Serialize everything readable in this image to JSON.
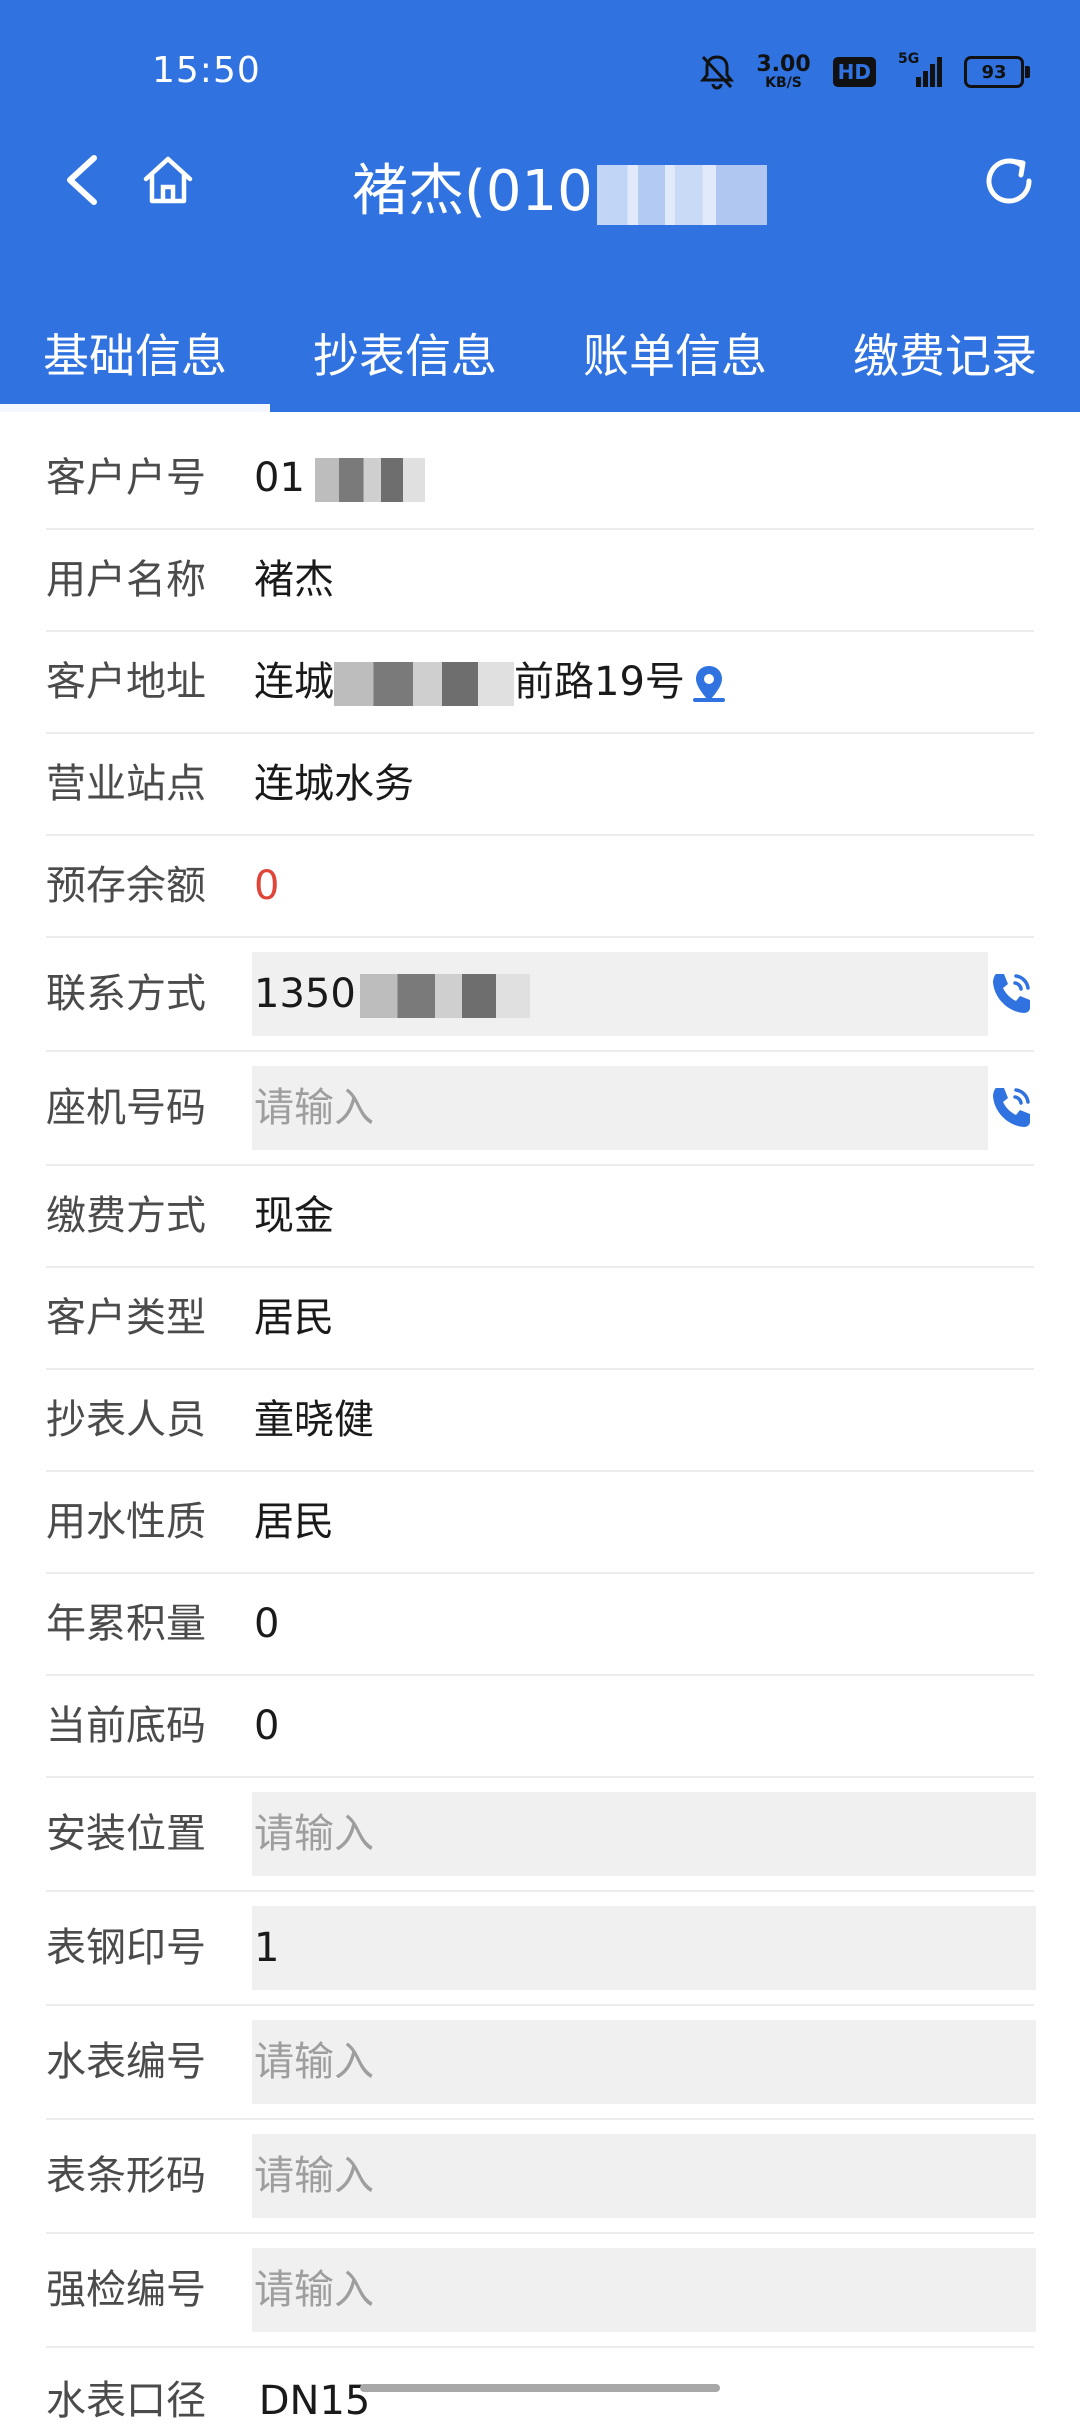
{
  "status_bar": {
    "time": "15:50",
    "net_speed": "3.00",
    "net_unit": "KB/S",
    "hd": "HD",
    "signal": "5G",
    "battery": "93",
    "icons": [
      "bell-off-icon",
      "signal-icon",
      "battery-icon"
    ]
  },
  "header": {
    "title": "褚杰(010",
    "back": "back-icon",
    "home": "home-icon",
    "refresh": "refresh-icon"
  },
  "tabs": [
    {
      "label": "基础信息",
      "active": true
    },
    {
      "label": "抄表信息",
      "active": false
    },
    {
      "label": "账单信息",
      "active": false
    },
    {
      "label": "缴费记录",
      "active": false
    }
  ],
  "fields": [
    {
      "label": "客户户号",
      "value": "01"
    },
    {
      "label": "用户名称",
      "value": "褚杰"
    },
    {
      "label": "客户地址",
      "value_start": "连城",
      "value_end": "前路19号"
    },
    {
      "label": "营业站点",
      "value": "连城水务"
    },
    {
      "label": "预存余额",
      "value": "0"
    },
    {
      "label": "联系方式",
      "value": "1350"
    },
    {
      "label": "座机号码",
      "placeholder": "请输入"
    },
    {
      "label": "缴费方式",
      "value": "现金"
    },
    {
      "label": "客户类型",
      "value": "居民"
    },
    {
      "label": "抄表人员",
      "value": "童晓健"
    },
    {
      "label": "用水性质",
      "value": "居民"
    },
    {
      "label": "年累积量",
      "value": "0"
    },
    {
      "label": "当前底码",
      "value": "0"
    },
    {
      "label": "安装位置",
      "placeholder": "请输入"
    },
    {
      "label": "表钢印号",
      "value": "1"
    },
    {
      "label": "水表编号",
      "placeholder": "请输入"
    },
    {
      "label": "表条形码",
      "placeholder": "请输入"
    },
    {
      "label": "强检编号",
      "placeholder": "请输入"
    },
    {
      "label": "水表口径",
      "value": "DN15"
    }
  ],
  "colors": {
    "header": "#2f72e0",
    "accent": "#2f72e0",
    "balance": "#e0453a"
  }
}
